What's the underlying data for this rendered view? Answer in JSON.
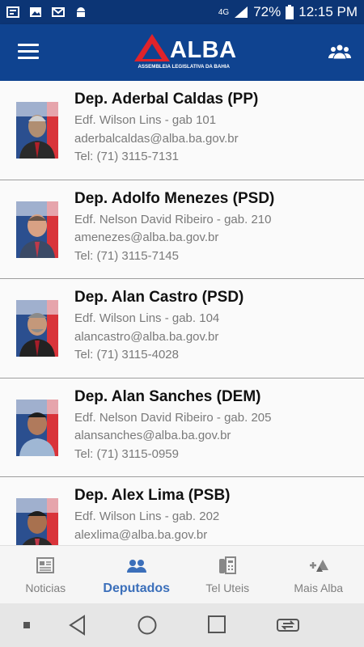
{
  "status_bar": {
    "network": "4G",
    "battery": "72%",
    "time": "12:15 PM"
  },
  "app": {
    "logo_text": "ALBA",
    "logo_subtitle": "ASSEMBLEIA LEGISLATIVA DA BAHIA"
  },
  "deputies": [
    {
      "name": "Dep. Aderbal Caldas (PP)",
      "office": "Edf. Wilson Lins - gab 101",
      "email": "aderbalcaldas@alba.ba.gov.br",
      "phone": "Tel: (71) 3115-7131"
    },
    {
      "name": "Dep. Adolfo Menezes (PSD)",
      "office": "Edf. Nelson David Ribeiro -  gab. 210",
      "email": "amenezes@alba.ba.gov.br",
      "phone": "Tel: (71) 3115-7145"
    },
    {
      "name": "Dep. Alan Castro (PSD)",
      "office": "Edf. Wilson Lins - gab. 104",
      "email": "alancastro@alba.ba.gov.br",
      "phone": "Tel: (71) 3115-4028"
    },
    {
      "name": "Dep. Alan Sanches (DEM)",
      "office": "Edf. Nelson David Ribeiro - gab. 205",
      "email": "alansanches@alba.ba.gov.br",
      "phone": "Tel: (71) 3115-0959"
    },
    {
      "name": "Dep. Alex Lima (PSB)",
      "office": "Edf. Wilson Lins - gab. 202",
      "email": "alexlima@alba.ba.gov.br",
      "phone": ""
    }
  ],
  "bottom_nav": [
    {
      "label": "Noticias",
      "icon": "newspaper-icon",
      "active": false
    },
    {
      "label": "Deputados",
      "icon": "people-icon",
      "active": true
    },
    {
      "label": "Tel Uteis",
      "icon": "phone-icon",
      "active": false
    },
    {
      "label": "Mais Alba",
      "icon": "more-icon",
      "active": false
    }
  ],
  "colors": {
    "app_bar": "#0f4390",
    "status_bar": "#0c3575",
    "accent": "#3b6fba",
    "logo_red": "#e0232a"
  }
}
